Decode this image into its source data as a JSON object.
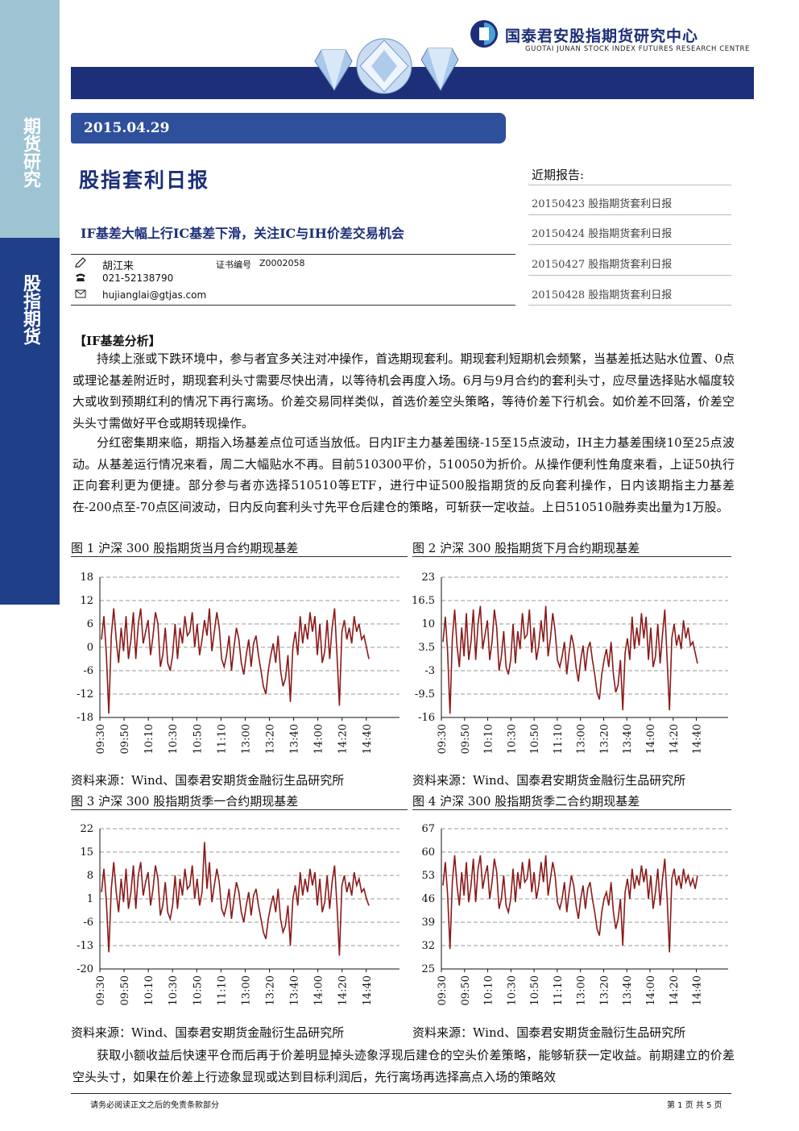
{
  "sidebar": {
    "top_label": "期货研究",
    "mid_label": "股指期货"
  },
  "header": {
    "org_cn": "国泰君安股指期货研究中心",
    "org_en": "GUOTAI JUNAN STOCK INDEX FUTURES RESEARCH CENTRE",
    "brand_color": "#1c2f78"
  },
  "report": {
    "date": "2015.04.29",
    "title": "股指套利日报",
    "subtitle": "IF基差大幅上行IC基差下滑，关注IC与IH价差交易机会",
    "author": "胡江来",
    "cert_label": "证书编号",
    "cert_no": "Z0002058",
    "phone": "021-52138790",
    "email": "hujianglai@gtjas.com"
  },
  "recent": {
    "title": "近期报告:",
    "items": [
      "20150423 股指期货套利日报",
      "20150424 股指期货套利日报",
      "20150427 股指期货套利日报",
      "20150428 股指期货套利日报"
    ]
  },
  "body": {
    "section_head": "【IF基差分析】",
    "para1": "持续上涨或下跌环境中，参与者宜多关注对冲操作，首选期现套利。期现套利短期机会频繁，当基差抵达贴水位置、0点或理论基差附近时，期现套利头寸需要尽快出清，以等待机会再度入场。6月与9月合约的套利头寸，应尽量选择贴水幅度较大或收到预期红利的情况下再行离场。价差交易同样类似，首选价差空头策略，等待价差下行机会。如价差不回落，价差空头头寸需做好平仓或期转现操作。",
    "para2": "分红密集期来临，期指入场基差点位可适当放低。日内IF主力基差围绕-15至15点波动，IH主力基差围绕10至25点波动。从基差运行情况来看，周二大幅贴水不再。目前510300平价，510050为折价。从操作便利性角度来看，上证50执行正向套利更为便捷。部分参与者亦选择510510等ETF，进行中证500股指期货的反向套利操作，日内该期指主力基差在-200点至-70点区间波动，日内反向套利头寸先平仓后建仓的策略，可斩获一定收益。上日510510融券卖出量为1万股。",
    "para3": "获取小额收益后快速平仓而后再于价差明显掉头迹象浮现后建仓的空头价差策略，能够斩获一定收益。前期建立的价差空头头寸，如果在价差上行迹象显现或达到目标利润后，先行离场再选择高点入场的策略效"
  },
  "figures": [
    {
      "title": "图 1 沪深 300 股指期货当月合约期现基差",
      "source": "资料来源：Wind、国泰君安期货金融衍生品研究所"
    },
    {
      "title": "图 2 沪深 300 股指期货下月合约期现基差",
      "source": "资料来源：Wind、国泰君安期货金融衍生品研究所"
    },
    {
      "title": "图 3 沪深 300 股指期货季一合约期现基差",
      "source": "资料来源：Wind、国泰君安期货金融衍生品研究所"
    },
    {
      "title": "图 4 沪深 300 股指期货季二合约期现基差",
      "source": "资料来源：Wind、国泰君安期货金融衍生品研究所"
    }
  ],
  "chart_data": [
    {
      "type": "line",
      "title": "",
      "x_ticks": [
        "09:30",
        "09:50",
        "10:10",
        "10:30",
        "10:50",
        "11:10",
        "13:00",
        "13:20",
        "13:40",
        "14:00",
        "14:20",
        "14:40"
      ],
      "y_ticks": [
        "18",
        "12",
        "6",
        "0",
        "-6",
        "-12",
        "-18"
      ],
      "ylim": [
        -18,
        18
      ],
      "grid": "dashed horizontal",
      "line_color": "#8b1a1a",
      "series": [
        {
          "values": [
            2,
            8,
            -2,
            -17,
            3,
            10,
            2,
            -4,
            5,
            -1,
            8,
            -3,
            2,
            9,
            -3,
            6,
            10,
            1,
            4,
            7,
            -2,
            3,
            9,
            6,
            -5,
            -2,
            5,
            -4,
            -6,
            -2,
            6,
            -3,
            5,
            1,
            8,
            3,
            4,
            9,
            0,
            6,
            -2,
            2,
            7,
            3,
            10,
            -1,
            4,
            9,
            5,
            -3,
            -5,
            -2,
            3,
            -6,
            0,
            5,
            2,
            -4,
            -7,
            -2,
            2,
            -5,
            1,
            3,
            -2,
            -6,
            -10,
            -12,
            -6,
            -2,
            1,
            -4,
            3,
            -6,
            -10,
            -8,
            -2,
            -14,
            0,
            4,
            -2,
            8,
            1,
            6,
            2,
            9,
            4,
            8,
            -2,
            6,
            -4,
            -1,
            7,
            -3,
            5,
            10,
            -2,
            -15,
            4,
            7,
            2,
            5,
            1,
            8,
            4,
            6,
            2,
            3,
            0,
            -3
          ]
        }
      ]
    },
    {
      "type": "line",
      "title": "",
      "x_ticks": [
        "09:30",
        "09:50",
        "10:10",
        "10:30",
        "10:50",
        "11:10",
        "13:00",
        "13:20",
        "13:40",
        "14:00",
        "14:20",
        "14:40"
      ],
      "y_ticks": [
        "23",
        "16.5",
        "10",
        "3.5",
        "-3",
        "-9.5",
        "-16"
      ],
      "ylim": [
        -16,
        23
      ],
      "grid": "dashed horizontal",
      "line_color": "#8b1a1a",
      "series": [
        {
          "values": [
            5,
            12,
            2,
            -15,
            6,
            14,
            4,
            -2,
            9,
            1,
            13,
            0,
            5,
            14,
            0,
            10,
            15,
            3,
            7,
            11,
            0,
            5,
            14,
            9,
            -3,
            1,
            8,
            -2,
            -4,
            0,
            10,
            -1,
            8,
            3,
            13,
            6,
            7,
            14,
            2,
            9,
            0,
            4,
            11,
            5,
            15,
            1,
            6,
            13,
            8,
            0,
            -2,
            1,
            5,
            -4,
            2,
            7,
            4,
            -2,
            -6,
            0,
            4,
            -3,
            3,
            5,
            0,
            -4,
            -9,
            -11,
            -4,
            0,
            3,
            -2,
            5,
            -4,
            -9,
            -7,
            0,
            -14,
            2,
            6,
            0,
            12,
            3,
            9,
            4,
            13,
            6,
            12,
            0,
            9,
            -2,
            1,
            10,
            -1,
            7,
            14,
            0,
            -14,
            6,
            10,
            4,
            7,
            3,
            11,
            6,
            9,
            4,
            5,
            2,
            -1
          ]
        }
      ]
    },
    {
      "type": "line",
      "title": "",
      "x_ticks": [
        "09:30",
        "09:50",
        "10:10",
        "10:30",
        "10:50",
        "11:10",
        "13:00",
        "13:20",
        "13:40",
        "14:00",
        "14:20",
        "14:40"
      ],
      "y_ticks": [
        "22",
        "15",
        "8",
        "1",
        "-6",
        "-13",
        "-20"
      ],
      "ylim": [
        -20,
        22
      ],
      "grid": "dashed horizontal",
      "line_color": "#8b1a1a",
      "series": [
        {
          "values": [
            3,
            10,
            0,
            -15,
            4,
            12,
            3,
            -3,
            7,
            0,
            10,
            -2,
            3,
            11,
            -2,
            8,
            12,
            2,
            6,
            9,
            -1,
            4,
            11,
            7,
            -4,
            -1,
            6,
            -3,
            -5,
            -1,
            8,
            -2,
            7,
            2,
            10,
            4,
            5,
            11,
            1,
            7,
            -1,
            3,
            18,
            4,
            12,
            0,
            5,
            10,
            6,
            -2,
            -4,
            -1,
            4,
            -5,
            1,
            6,
            3,
            -3,
            -6,
            -1,
            3,
            -4,
            2,
            4,
            -1,
            -5,
            -9,
            -11,
            -5,
            -1,
            2,
            -3,
            4,
            -5,
            -9,
            -7,
            -1,
            -13,
            1,
            5,
            -1,
            9,
            2,
            7,
            3,
            10,
            5,
            9,
            -1,
            7,
            -3,
            0,
            8,
            -2,
            6,
            11,
            -1,
            -16,
            5,
            8,
            3,
            6,
            2,
            9,
            5,
            7,
            3,
            4,
            1,
            -1
          ]
        }
      ]
    },
    {
      "type": "line",
      "title": "",
      "x_ticks": [
        "09:30",
        "09:50",
        "10:10",
        "10:30",
        "10:50",
        "11:10",
        "13:00",
        "13:20",
        "13:40",
        "14:00",
        "14:20",
        "14:40"
      ],
      "y_ticks": [
        "67",
        "60",
        "53",
        "46",
        "39",
        "32",
        "25"
      ],
      "ylim": [
        25,
        67
      ],
      "grid": "dashed horizontal",
      "line_color": "#8b1a1a",
      "series": [
        {
          "values": [
            50,
            57,
            47,
            31,
            51,
            59,
            50,
            44,
            54,
            47,
            57,
            45,
            50,
            58,
            45,
            55,
            59,
            49,
            53,
            56,
            46,
            51,
            58,
            54,
            43,
            46,
            53,
            44,
            42,
            46,
            55,
            45,
            54,
            49,
            57,
            51,
            52,
            58,
            48,
            54,
            46,
            50,
            57,
            51,
            59,
            47,
            52,
            57,
            53,
            45,
            43,
            46,
            51,
            42,
            48,
            53,
            50,
            44,
            40,
            46,
            50,
            43,
            49,
            51,
            46,
            42,
            37,
            35,
            42,
            46,
            48,
            44,
            51,
            42,
            37,
            40,
            46,
            32,
            48,
            52,
            46,
            55,
            49,
            53,
            50,
            56,
            51,
            55,
            46,
            53,
            43,
            48,
            55,
            44,
            52,
            58,
            46,
            30,
            52,
            55,
            50,
            53,
            49,
            55,
            51,
            53,
            50,
            52,
            49,
            53
          ]
        }
      ]
    }
  ],
  "footer": {
    "left": "请务必阅读正文之后的免责条款部分",
    "right": "第 1 页 共 5 页"
  }
}
